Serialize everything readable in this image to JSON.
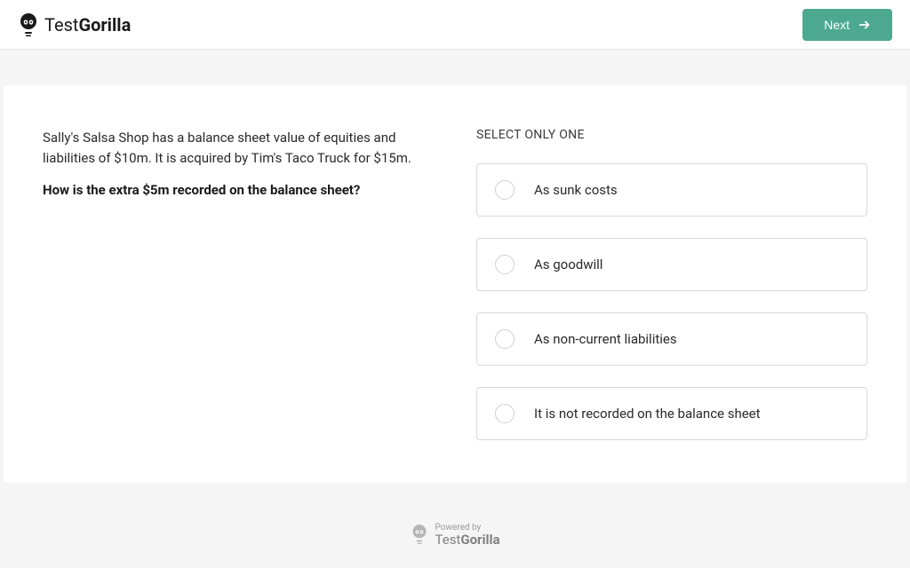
{
  "header": {
    "brand_light": "Test",
    "brand_bold": "Gorilla",
    "next_label": "Next"
  },
  "question": {
    "context": "Sally's Salsa Shop has a balance sheet value of equities and liabilities of $10m. It is acquired by Tim's Taco Truck for $15m.",
    "prompt": "How is the extra $5m recorded on the balance sheet?"
  },
  "answers": {
    "instruction": "SELECT ONLY ONE",
    "options": [
      "As sunk costs",
      "As goodwill",
      "As non-current liabilities",
      "It is not recorded on the balance sheet"
    ]
  },
  "footer": {
    "powered_by": "Powered by",
    "brand_light": "Test",
    "brand_bold": "Gorilla"
  }
}
